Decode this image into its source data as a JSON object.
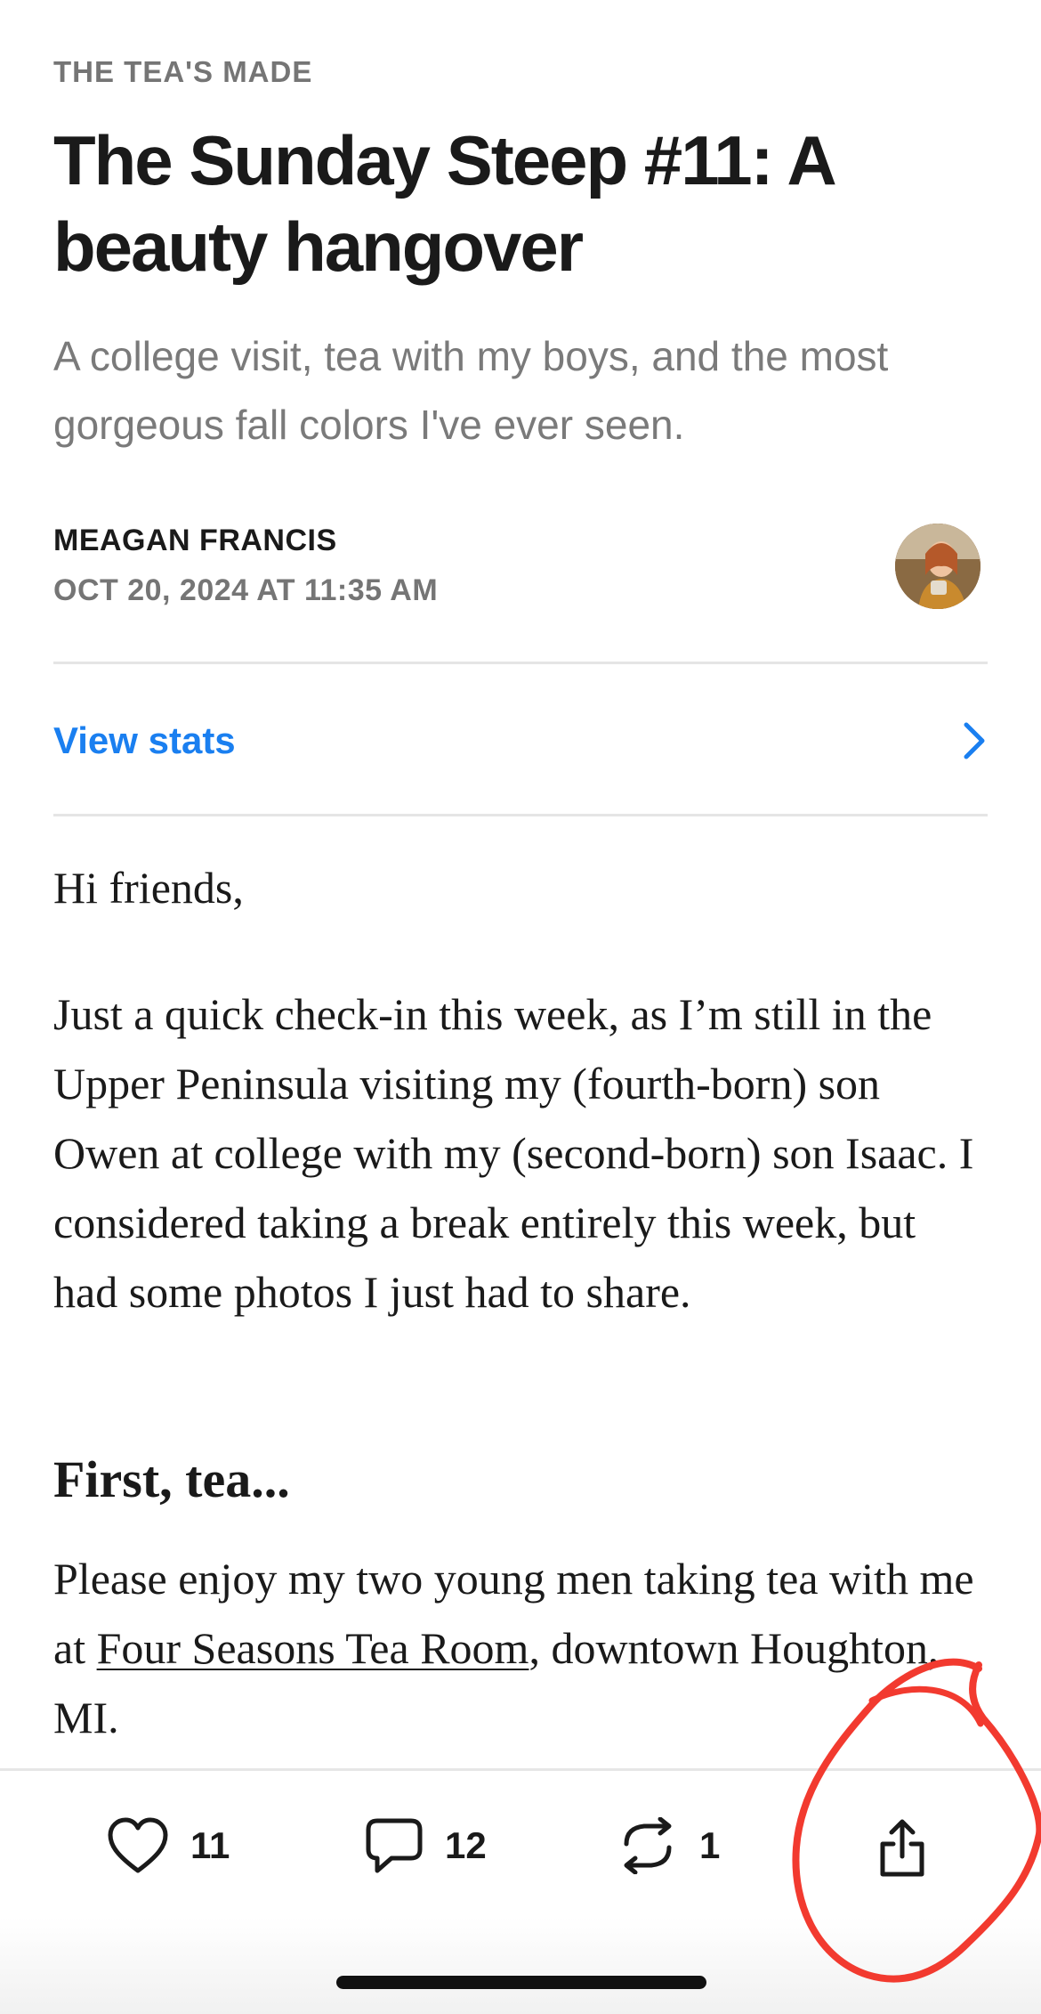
{
  "post": {
    "publication": "THE TEA'S MADE",
    "title": "The Sunday Steep #11: A beauty hangover",
    "subtitle": "A college visit, tea with my boys, and the most gorgeous fall colors I've ever seen.",
    "author": "MEAGAN FRANCIS",
    "date": "OCT 20, 2024 AT 11:35 AM"
  },
  "stats": {
    "label": "View stats"
  },
  "body": {
    "greeting": "Hi friends,",
    "paragraph1": "Just a quick check-in this week, as I’m still in the Upper Peninsula visiting my (fourth-born) son Owen at college with my (second-born) son Isaac. I considered taking a break entirely this week, but had some photos I just had to share.",
    "heading": "First, tea...",
    "paragraph2_before": "Please enjoy my two young men taking tea with me at ",
    "paragraph2_link": "Four Seasons Tea Room",
    "paragraph2_after": ", downtown Houghton, MI."
  },
  "actions": {
    "likes": "11",
    "comments": "12",
    "restacks": "1"
  },
  "icons": {
    "like": "heart-icon",
    "comment": "comment-bubble-icon",
    "restack": "restack-icon",
    "share": "share-icon",
    "chevron": "chevron-right-icon"
  },
  "colors": {
    "accent": "#1a7ff0",
    "annotation": "#f23a2f"
  }
}
